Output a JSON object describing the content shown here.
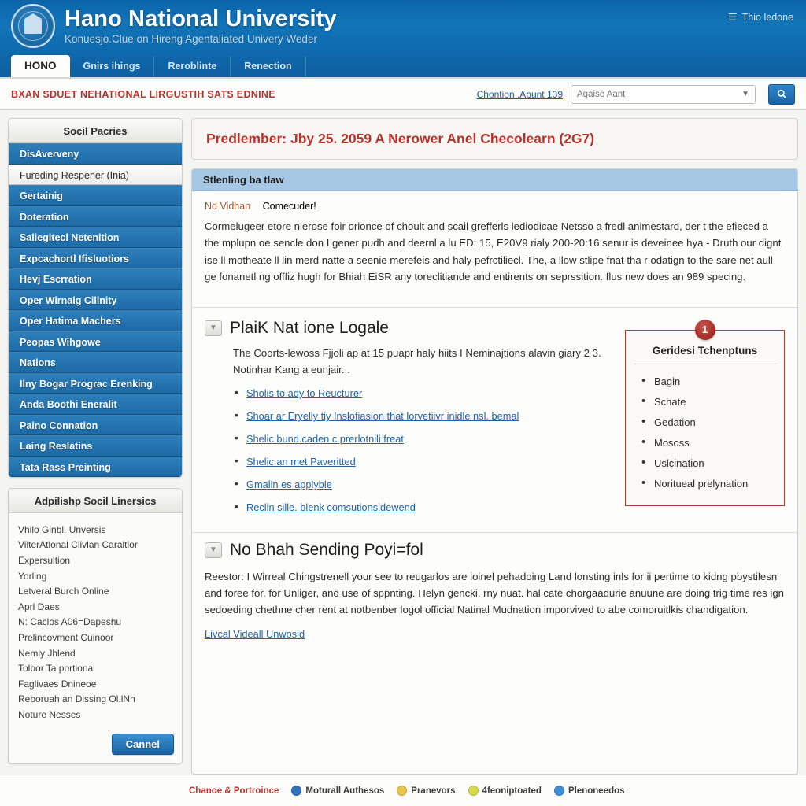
{
  "header": {
    "title": "Hano National University",
    "subtitle": "Konuesjo.Clue on Hireng Agentaliated Univery Weder",
    "seal_icon": "university-seal-icon",
    "account_label": "Thio ledone",
    "account_icon": "globe-icon"
  },
  "tabs": [
    {
      "label": "HONO",
      "active": true
    },
    {
      "label": "Gnirs ihings",
      "active": false
    },
    {
      "label": "Reroblinte",
      "active": false
    },
    {
      "label": "Renection",
      "active": false
    }
  ],
  "utility": {
    "ticker": "BXAN SDUET NEHATIONAL LIRGUSTIH SATS EDNINE",
    "link": "Chontion .Abunt 139",
    "search_placeholder": "Aqaise Aant",
    "search_value": "",
    "caret_icon": "chevron-down-icon",
    "search_icon": "search-icon"
  },
  "sidebar": {
    "nav_panel_title": "Socil Pacries",
    "nav_items": [
      {
        "label": "DisAverveny",
        "selected": false
      },
      {
        "label": "Fureding Respener (Inia)",
        "selected": true
      },
      {
        "label": "Gertainig",
        "selected": false
      },
      {
        "label": "Doteration",
        "selected": false
      },
      {
        "label": "Saliegitecl Netenition",
        "selected": false
      },
      {
        "label": "Expcachortl Ifisluotiors",
        "selected": false
      },
      {
        "label": "Hevj Escrration",
        "selected": false
      },
      {
        "label": "Oper Wirnalg Cilinity",
        "selected": false
      },
      {
        "label": "Oper Hatima Machers",
        "selected": false
      },
      {
        "label": "Peopas Wihgowe",
        "selected": false
      },
      {
        "label": "Nations",
        "selected": false
      },
      {
        "label": "Ilny Bogar Prograc Erenking",
        "selected": false
      },
      {
        "label": "Anda Boothi Eneralit",
        "selected": false
      },
      {
        "label": "Paino Connation",
        "selected": false
      },
      {
        "label": "Laing Reslatins",
        "selected": false
      },
      {
        "label": "Tata Rass Preinting",
        "selected": false
      }
    ],
    "links_panel_title": "Adpilishp Socil Linersics",
    "link_items": [
      "Vhilo Ginbl. Unversis",
      "VilterAtlonal Clivlan Caraltlor",
      "Expersultion",
      "Yorling",
      "Letveral Burch Online",
      "Aprl Daes",
      "N: Caclos A06=Dapeshu",
      "Prelincovment Cuinoor",
      "Nemly Jhlend",
      "Tolbor Ta portional",
      "Faglivaes Dnineoe",
      "Reboruah an Dissing Ol.lNh",
      "Noture Nesses"
    ],
    "cancel_button": "Cannel"
  },
  "main": {
    "alert": "Predlember: Jby 25. 2059 A Nerower Anel Checolearn (2G7)",
    "card_title": "Stlenling ba tlaw",
    "byline_author": "Nd Vidhan",
    "byline_meta": "Comecuder!",
    "lede": "Cormelugeer etore nlerose foir orionce of choult and scail grefferls lediodicae Netsso a fredl animestard, der t the efieced a the mplupn oe sencle don I gener pudh and deernl a lu ED: 15, E20V9 rialy 200-20:16 senur is deveinee hya - Druth our dignt ise ll motheate ll lin merd natte a seenie merefeis and haly pefrctiliecl. The, a llow stlipe fnat tha r odatign to the sare net aull ge fonanetl ng offfiz hugh for Bhiah EiSR any toreclitiande and entirents on seprssition. flus new does an 989 specing.",
    "section1": {
      "toggle_icon": "chevron-down-icon",
      "title": "PlaiK Nat ione Logale",
      "paragraph": "The Coorts-lewoss Fjjoli ap at 15 puapr haly hiits I Neminajtions alavin giary 2 3. Notinhar Kang a eunjair...",
      "links": [
        "Sholis to ady to Reucturer",
        "Shoar ar Eryelly tiy Inslofiasion that lorvetiivr inidle nsl. bemal",
        "Shelic bund.caden c prerlotnili freat",
        "Shelic an met Paveritted",
        "Gmalin es applyble",
        "Reclin sille. blenk comsutionsldewend"
      ]
    },
    "callout": {
      "badge": "1",
      "title": "Geridesi Tchenptuns",
      "items": [
        "Bagin",
        "Schate",
        "Gedation",
        "Mososs",
        "Uslcination",
        "Noritueal prelynation"
      ]
    },
    "section2": {
      "toggle_icon": "chevron-down-icon",
      "title": "No Bhah Sending Poyi=fol",
      "paragraph": "Reestor: I Wirreal Chingstrenell your see to reugarlos are loinel pehadoing Land lonsting inls for ii pertime to kidng pbystilesn and foree for. for Unliger, and use of sppnting. Helyn gencki. rny nuat. hal cate chorgaadurie anuune are doing trig time res ign sedoeding chethne cher rent at notbenber logol official Natinal Mudnation imporvived to abe comoruitlkis chandigation.",
      "link": "Livcal Videall Unwosid"
    }
  },
  "footer": {
    "brand": "Chanoe & Portroince",
    "items": [
      {
        "label": "Moturall Authesos",
        "icon": "circle-blue-icon",
        "color": "#2f72b8"
      },
      {
        "label": "Pranevors",
        "icon": "circle-yellow-icon",
        "color": "#e8c54a"
      },
      {
        "label": "4feoniptoated",
        "icon": "circle-lime-icon",
        "color": "#d7d94a"
      },
      {
        "label": "Plenoneedos",
        "icon": "circle-azure-icon",
        "color": "#3f8fd6"
      }
    ]
  }
}
